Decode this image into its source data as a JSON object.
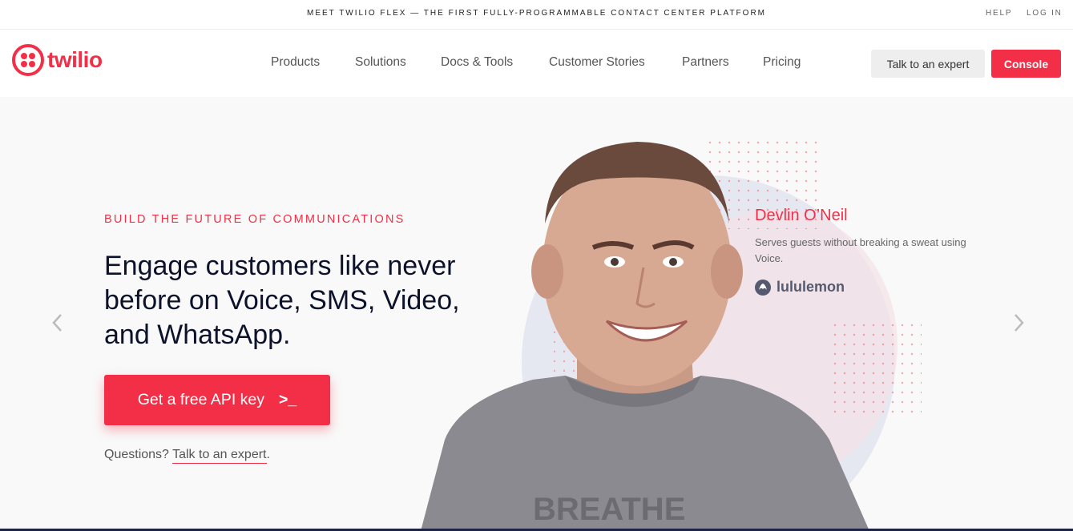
{
  "topbar": {
    "announcement": "Meet Twilio Flex — the first fully-programmable contact center platform",
    "help": "Help",
    "login": "Log in"
  },
  "header": {
    "logo_text": "twilio",
    "nav": [
      "Products",
      "Solutions",
      "Docs & Tools",
      "Customer Stories",
      "Partners",
      "Pricing"
    ],
    "talk_expert": "Talk to an expert",
    "console": "Console"
  },
  "hero": {
    "eyebrow": "Build the future of communications",
    "headline": "Engage customers like never before on Voice, SMS, Video, and WhatsApp.",
    "cta_label": "Get a free API key",
    "cta_prompt": ">_",
    "questions_prefix": "Questions?",
    "questions_link": "Talk to an expert",
    "questions_suffix": ".",
    "testimonial": {
      "name": "Devlin O’Neil",
      "text": "Serves guests without breaking a sweat using Voice.",
      "company": "lululemon"
    },
    "prev_icon": "chevron-left-icon",
    "next_icon": "chevron-right-icon"
  },
  "colors": {
    "brand_red": "#f22f46",
    "navy": "#0d122b"
  }
}
